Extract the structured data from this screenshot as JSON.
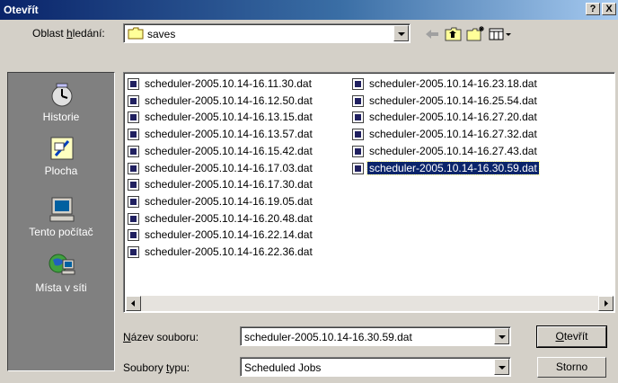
{
  "window": {
    "title": "Otevřít",
    "help_button": "?",
    "close_button": "X"
  },
  "look_in": {
    "label_pre": "Oblast ",
    "label_ul": "h",
    "label_post": "ledání:",
    "value": "saves"
  },
  "places": [
    {
      "label": "Historie",
      "icon": "history-icon"
    },
    {
      "label": "Plocha",
      "icon": "desktop-icon"
    },
    {
      "label": "Tento počítač",
      "icon": "my-computer-icon"
    },
    {
      "label": "Místa v síti",
      "icon": "network-places-icon"
    }
  ],
  "files": [
    "scheduler-2005.10.14-16.11.30.dat",
    "scheduler-2005.10.14-16.12.50.dat",
    "scheduler-2005.10.14-16.13.15.dat",
    "scheduler-2005.10.14-16.13.57.dat",
    "scheduler-2005.10.14-16.15.42.dat",
    "scheduler-2005.10.14-16.17.03.dat",
    "scheduler-2005.10.14-16.17.30.dat",
    "scheduler-2005.10.14-16.19.05.dat",
    "scheduler-2005.10.14-16.20.48.dat",
    "scheduler-2005.10.14-16.22.14.dat",
    "scheduler-2005.10.14-16.22.36.dat",
    "scheduler-2005.10.14-16.23.18.dat",
    "scheduler-2005.10.14-16.25.54.dat",
    "scheduler-2005.10.14-16.27.20.dat",
    "scheduler-2005.10.14-16.27.32.dat",
    "scheduler-2005.10.14-16.27.43.dat",
    "scheduler-2005.10.14-16.30.59.dat"
  ],
  "selected_file": "scheduler-2005.10.14-16.30.59.dat",
  "filename": {
    "label_ul": "N",
    "label_post": "ázev souboru:",
    "value": "scheduler-2005.10.14-16.30.59.dat"
  },
  "filetype": {
    "label_pre": "Soubory ",
    "label_ul": "t",
    "label_post": "ypu:",
    "value": "Scheduled Jobs"
  },
  "buttons": {
    "open_ul": "O",
    "open_post": "tevřít",
    "cancel": "Storno"
  },
  "colors": {
    "title_bar": "#0a246a",
    "selection": "#0a246a",
    "places_bar": "#808080",
    "face": "#d4d0c8"
  }
}
